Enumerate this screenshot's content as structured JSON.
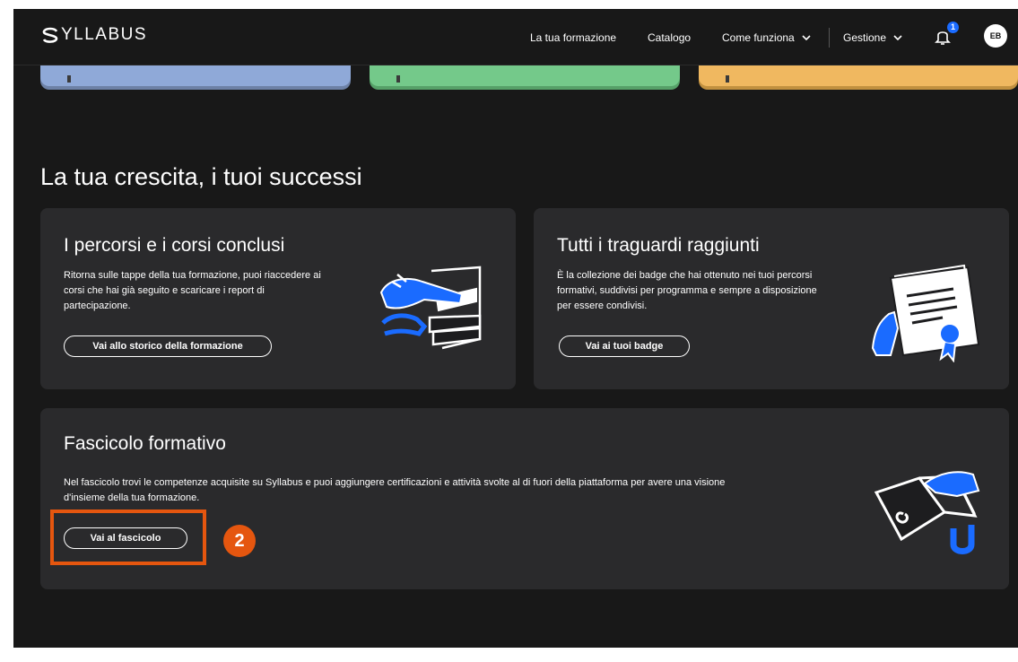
{
  "header": {
    "logo_text": "YLLABUS",
    "nav": [
      {
        "label": "La tua formazione"
      },
      {
        "label": "Catalogo"
      },
      {
        "label": "Come funziona"
      },
      {
        "label": "Gestione"
      }
    ],
    "notification_count": "1",
    "avatar_initials": "EB"
  },
  "section": {
    "title": "La tua crescita, i tuoi successi"
  },
  "cards": {
    "storico": {
      "title": "I percorsi e i corsi conclusi",
      "lines": [
        "Ritorna sulle tappe della tua formazione, puoi riaccedere ai",
        "corsi che hai già seguito e scaricare i report di",
        "partecipazione."
      ],
      "button": "Vai allo storico della formazione",
      "icon": "books-hand-illustration"
    },
    "badge": {
      "title": "Tutti i traguardi raggiunti",
      "lines": [
        "È la collezione dei badge che hai ottenuto nei tuoi percorsi",
        "formativi, suddivisi per programma e sempre a disposizione",
        "per essere condivisi."
      ],
      "button": "Vai ai tuoi badge",
      "icon": "certificate-ribbon-illustration"
    },
    "fascicolo": {
      "title": "Fascicolo formativo",
      "lines": [
        "Nel fascicolo trovi le competenze acquisite su Syllabus e puoi aggiungere certificazioni e attività svolte al di fuori della piattaforma per avere una visione",
        "d'insieme della tua formazione."
      ],
      "button": "Vai al fascicolo",
      "icon": "folder-magnet-illustration"
    }
  },
  "annotation": {
    "step_number": "2",
    "color": "#e5560f"
  },
  "colors": {
    "background": "#181818",
    "card": "#2a2a2c",
    "accent_blue": "#1a6bff"
  }
}
